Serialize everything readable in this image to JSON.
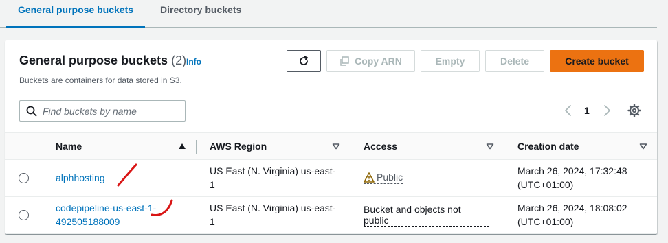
{
  "tabs": [
    {
      "label": "General purpose buckets",
      "active": true
    },
    {
      "label": "Directory buckets",
      "active": false
    }
  ],
  "panel": {
    "title": "General purpose buckets",
    "count": "(2)",
    "info": "Info",
    "subtitle": "Buckets are containers for data stored in S3."
  },
  "actions": {
    "copy_arn": "Copy ARN",
    "empty": "Empty",
    "delete": "Delete",
    "create": "Create bucket"
  },
  "search": {
    "placeholder": "Find buckets by name",
    "value": ""
  },
  "pagination": {
    "page": "1"
  },
  "table": {
    "columns": [
      "Name",
      "AWS Region",
      "Access",
      "Creation date"
    ],
    "rows": [
      {
        "name": "alphhosting",
        "region_line1": "US East (N. Virginia) us-east-",
        "region_line2": "1",
        "access": "Public",
        "date_line1": "March 26, 2024, 17:32:48",
        "date_line2": "(UTC+01:00)"
      },
      {
        "name_line1": "codepipeline-us-east-1-",
        "name_line2": "492505188009",
        "region_line1": "US East (N. Virginia) us-east-",
        "region_line2": "1",
        "access_line1": "Bucket and objects not",
        "access_line2": "public",
        "date_line1": "March 26, 2024, 18:08:02",
        "date_line2": "(UTC+01:00)"
      }
    ]
  },
  "colors": {
    "link": "#0073bb",
    "primary_button": "#ec7211",
    "warning_icon": "#8d6605",
    "annotation_mark": "#d91515"
  },
  "icons": {
    "refresh": "refresh-icon",
    "copy": "copy-icon",
    "search": "search-icon",
    "prev": "chevron-left-icon",
    "next": "chevron-right-icon",
    "settings": "gear-icon",
    "sort_asc": "caret-up-icon",
    "sort_desc": "caret-down-icon",
    "warning": "warning-icon"
  }
}
